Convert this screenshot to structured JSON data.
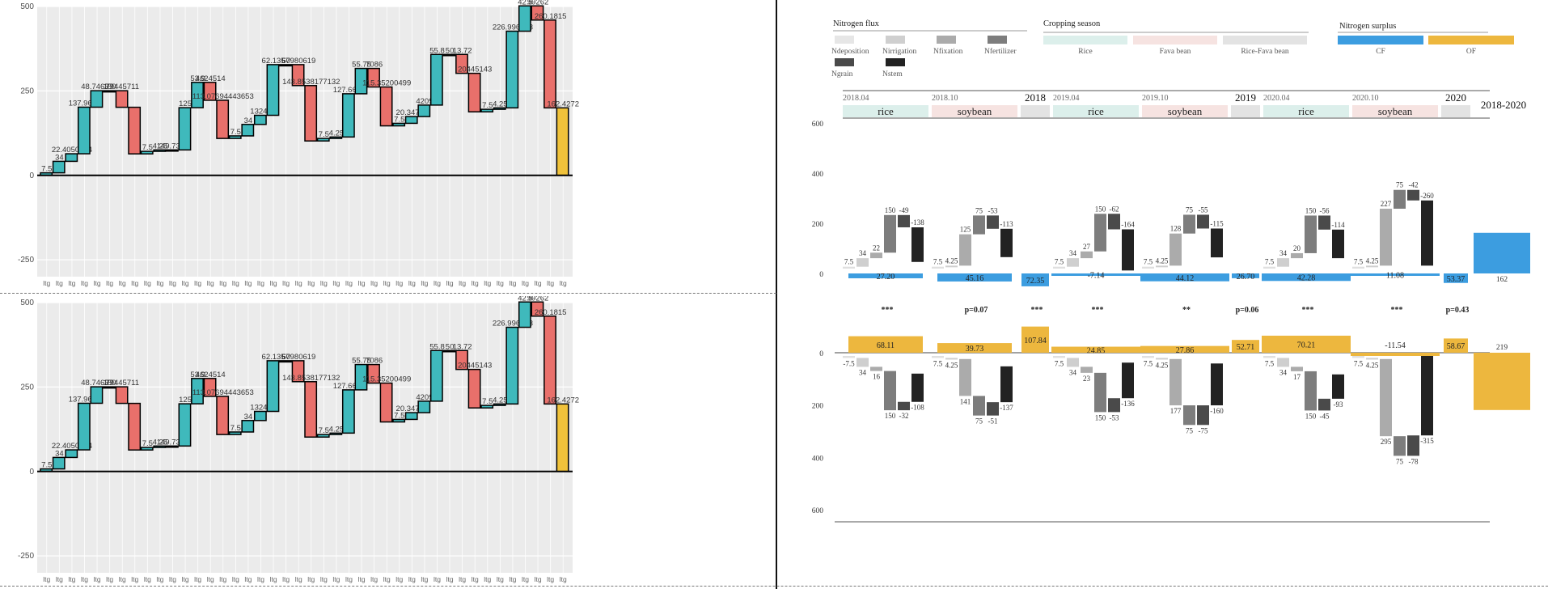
{
  "chart_data": [
    {
      "type": "bar",
      "subtype": "waterfall",
      "panel": "left-top",
      "ylim": [
        -300,
        500
      ],
      "yticks": [
        -250,
        0,
        250,
        500
      ],
      "grid": true,
      "steps": [
        {
          "label": "7.5",
          "delta": 7.5,
          "color": "#3fb9bc"
        },
        {
          "label": "34",
          "delta": 34,
          "color": "#3fb9bc"
        },
        {
          "label": "22.4050004",
          "delta": 22.4,
          "color": "#3fb9bc"
        },
        {
          "label": "137.9626",
          "delta": 137.96,
          "color": "#3fb9bc"
        },
        {
          "label": "48.74637",
          "delta": 48.7,
          "color": "#3fb9bc"
        },
        {
          "label": "150",
          "delta": 0,
          "color": "#3fb9bc"
        },
        {
          "label": "79445711",
          "delta": -49,
          "color": "#e9706b"
        },
        {
          "label": "",
          "delta": -138,
          "color": "#e9706b"
        },
        {
          "label": "7.5",
          "delta": 7.5,
          "color": "#3fb9bc"
        },
        {
          "label": "4.25",
          "delta": 4.25,
          "color": "#3fb9bc"
        },
        {
          "label": "149.7334",
          "delta": 0,
          "color": "#3fb9bc"
        },
        {
          "label": "125",
          "delta": 125,
          "color": "#3fb9bc"
        },
        {
          "label": "53.9",
          "delta": 75,
          "color": "#3fb9bc"
        },
        {
          "label": "4624514",
          "delta": -53,
          "color": "#e9706b"
        },
        {
          "label": "113.07694443653",
          "delta": -113,
          "color": "#e9706b"
        },
        {
          "label": "7.5",
          "delta": 7.5,
          "color": "#3fb9bc"
        },
        {
          "label": "34",
          "delta": 34,
          "color": "#3fb9bc"
        },
        {
          "label": "13249",
          "delta": 27,
          "color": "#3fb9bc"
        },
        {
          "label": "62.135",
          "delta": 150,
          "color": "#3fb9bc"
        },
        {
          "label": "50",
          "delta": 0,
          "color": "#3fb9bc"
        },
        {
          "label": "67980619",
          "delta": -62,
          "color": "#e9706b"
        },
        {
          "label": "143.8538177132",
          "delta": -164,
          "color": "#e9706b"
        },
        {
          "label": "7.5",
          "delta": 7.5,
          "color": "#3fb9bc"
        },
        {
          "label": "4.25",
          "delta": 4.25,
          "color": "#3fb9bc"
        },
        {
          "label": "127.6694",
          "delta": 128,
          "color": "#3fb9bc"
        },
        {
          "label": "55.75",
          "delta": 75,
          "color": "#3fb9bc"
        },
        {
          "label": "7086",
          "delta": -55,
          "color": "#e9706b"
        },
        {
          "label": "115.35200499",
          "delta": -115,
          "color": "#e9706b"
        },
        {
          "label": "7.5",
          "delta": 7.5,
          "color": "#3fb9bc"
        },
        {
          "label": "20.34749",
          "delta": 20,
          "color": "#3fb9bc"
        },
        {
          "label": "4209",
          "delta": 34,
          "color": "#3fb9bc"
        },
        {
          "label": "55.8",
          "delta": 150,
          "color": "#3fb9bc"
        },
        {
          "label": "50",
          "delta": 0,
          "color": "#3fb9bc"
        },
        {
          "label": "13.72",
          "delta": -56,
          "color": "#e9706b"
        },
        {
          "label": "20445143",
          "delta": -114,
          "color": "#e9706b"
        },
        {
          "label": "7.5",
          "delta": 7.5,
          "color": "#3fb9bc"
        },
        {
          "label": "4.25",
          "delta": 4.25,
          "color": "#3fb9bc"
        },
        {
          "label": "226.996043",
          "delta": 227,
          "color": "#3fb9bc"
        },
        {
          "label": "42.5",
          "delta": 75,
          "color": "#3fb9bc"
        },
        {
          "label": "99262",
          "delta": -42,
          "color": "#e9706b"
        },
        {
          "label": "260.1815",
          "delta": -260,
          "color": "#e9706b"
        },
        {
          "label": "162.4272",
          "delta": 0,
          "color": "#f0c23b",
          "total": true
        }
      ]
    },
    {
      "type": "bar",
      "subtype": "waterfall",
      "panel": "left-bottom",
      "ylim": [
        -300,
        500
      ],
      "yticks": [
        -250,
        0,
        250,
        500
      ],
      "grid": true,
      "same_as": "left-top"
    },
    {
      "type": "bar",
      "subtype": "waterfall",
      "panel": "right",
      "legend": {
        "nitrogen_flux_title": "Nitrogen flux",
        "nitrogen_flux": [
          {
            "name": "Ndeposition",
            "color": "#e6e6e6"
          },
          {
            "name": "Nirrigation",
            "color": "#cfcfcf"
          },
          {
            "name": "Nfixation",
            "color": "#ababab"
          },
          {
            "name": "Nfertilizer",
            "color": "#7d7d7d"
          },
          {
            "name": "Ngrain",
            "color": "#4a4a4a"
          },
          {
            "name": "Nstem",
            "color": "#222222"
          }
        ],
        "cropping_title": "Cropping season",
        "cropping": [
          {
            "name": "Rice",
            "color": "#dcefeb"
          },
          {
            "name": "Fava bean",
            "color": "#f6e3e1"
          },
          {
            "name": "Rice-Fava bean",
            "color": "#e3e3e3"
          }
        ],
        "surplus_title": "Nitrogen surplus",
        "surplus": [
          {
            "name": "CF",
            "color": "#3c9de0"
          },
          {
            "name": "OF",
            "color": "#edb73e"
          }
        ]
      },
      "seasons": [
        {
          "date": "2018.04",
          "crop": "rice",
          "color": "#dcefeb"
        },
        {
          "date": "2018.10",
          "crop": "soybean",
          "color": "#f6e3e1"
        },
        {
          "year": "2018"
        },
        {
          "date": "2019.04",
          "crop": "rice",
          "color": "#dcefeb"
        },
        {
          "date": "2019.10",
          "crop": "soybean",
          "color": "#f6e3e1"
        },
        {
          "year": "2019"
        },
        {
          "date": "2020.04",
          "crop": "rice",
          "color": "#dcefeb"
        },
        {
          "date": "2020.10",
          "crop": "soybean",
          "color": "#f6e3e1"
        },
        {
          "year": "2020"
        },
        {
          "year": "2018-2020"
        }
      ],
      "yticks_top": [
        600,
        400,
        200,
        0
      ],
      "yticks_bottom": [
        0,
        200,
        400,
        600
      ],
      "cf_flux_labels": [
        [
          "7.5",
          "34",
          "22",
          "150",
          "-49",
          "-138"
        ],
        [
          "7.5",
          "4.25",
          "125",
          "75",
          "-53",
          "-113"
        ],
        [
          "7.5",
          "34",
          "27",
          "150",
          "-62",
          "-164"
        ],
        [
          "7.5",
          "4.25",
          "128",
          "75",
          "-55",
          "-115"
        ],
        [
          "7.5",
          "34",
          "20",
          "150",
          "-56",
          "-114"
        ],
        [
          "7.5",
          "4.25",
          "227",
          "75",
          "-42",
          "-260"
        ]
      ],
      "of_flux_labels": [
        [
          "-7.5",
          "34",
          "16",
          "150",
          "-32",
          "-108"
        ],
        [
          "7.5",
          "4.25",
          "141",
          "75",
          "-51",
          "-137"
        ],
        [
          "7.5",
          "34",
          "23",
          "150",
          "-53",
          "-136"
        ],
        [
          "7.5",
          "4.25",
          "177",
          "75",
          "-75",
          "-160"
        ],
        [
          "7.5",
          "34",
          "17",
          "150",
          "-45",
          "-93"
        ],
        [
          "7.5",
          "4.25",
          "295",
          "75",
          "-78",
          "-315"
        ]
      ],
      "cf_surplus": [
        "27.20",
        "45.16",
        "72.35",
        "-7.14",
        "44.12",
        "26.70",
        "42.28",
        "11.08",
        "53.37",
        "162"
      ],
      "of_surplus": [
        "68.11",
        "39.73",
        "107.84",
        "24.85",
        "27.86",
        "52.71",
        "70.21",
        "-11.54",
        "58.67",
        "219"
      ],
      "significance": [
        "***",
        "p=0.07",
        "***",
        "***",
        "**",
        "p=0.06",
        "***",
        "***",
        "p=0.43"
      ]
    }
  ]
}
